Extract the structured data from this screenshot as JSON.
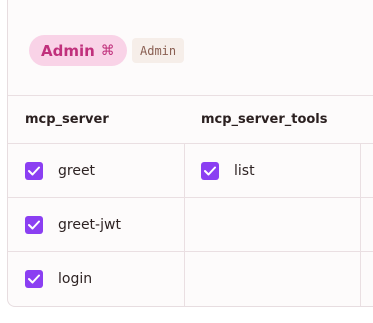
{
  "role": {
    "name": "Admin",
    "shortcut_glyph": "⌘",
    "code": "Admin",
    "pill_bg": "#f9d3e7",
    "pill_fg": "#c0307c"
  },
  "table": {
    "columns": [
      "mcp_server",
      "mcp_server_tools"
    ],
    "rows": [
      {
        "mcp_server": {
          "label": "greet",
          "checked": true
        },
        "mcp_server_tools": {
          "label": "list",
          "checked": true
        }
      },
      {
        "mcp_server": {
          "label": "greet-jwt",
          "checked": true
        },
        "mcp_server_tools": null
      },
      {
        "mcp_server": {
          "label": "login",
          "checked": true
        },
        "mcp_server_tools": null
      }
    ]
  },
  "colors": {
    "checkbox_accent": "#8b3ff2",
    "border": "#eadfe2"
  }
}
